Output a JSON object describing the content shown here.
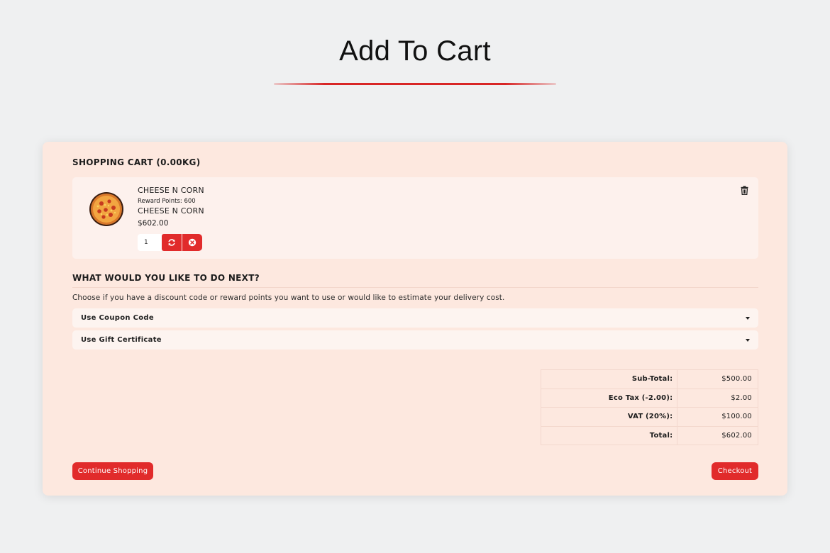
{
  "page": {
    "title": "Add To Cart"
  },
  "cart": {
    "heading": "SHOPPING CART  (0.00KG)",
    "item": {
      "name": "CHEESE N CORN",
      "reward_points": "Reward Points: 600",
      "model": "CHEESE N CORN",
      "price": "$602.00",
      "quantity": "1"
    }
  },
  "next": {
    "heading": "WHAT WOULD YOU LIKE TO DO NEXT?",
    "description": "Choose if you have a discount code or reward points you want to use or would like to estimate your delivery cost.",
    "options": [
      {
        "label": "Use Coupon Code"
      },
      {
        "label": "Use Gift Certificate"
      }
    ]
  },
  "totals": [
    {
      "label": "Sub-Total:",
      "value": "$500.00"
    },
    {
      "label": "Eco Tax (-2.00):",
      "value": "$2.00"
    },
    {
      "label": "VAT (20%):",
      "value": "$100.00"
    },
    {
      "label": "Total:",
      "value": "$602.00"
    }
  ],
  "actions": {
    "continue_label": "Continue Shopping",
    "checkout_label": "Checkout"
  },
  "colors": {
    "accent": "#e12b2b",
    "panel_bg": "#fde8df",
    "page_bg": "#eff0f1"
  },
  "icons": {
    "refresh": "refresh-icon",
    "remove": "close-circle-icon",
    "delete": "trash-icon",
    "caret": "caret-down-icon"
  }
}
